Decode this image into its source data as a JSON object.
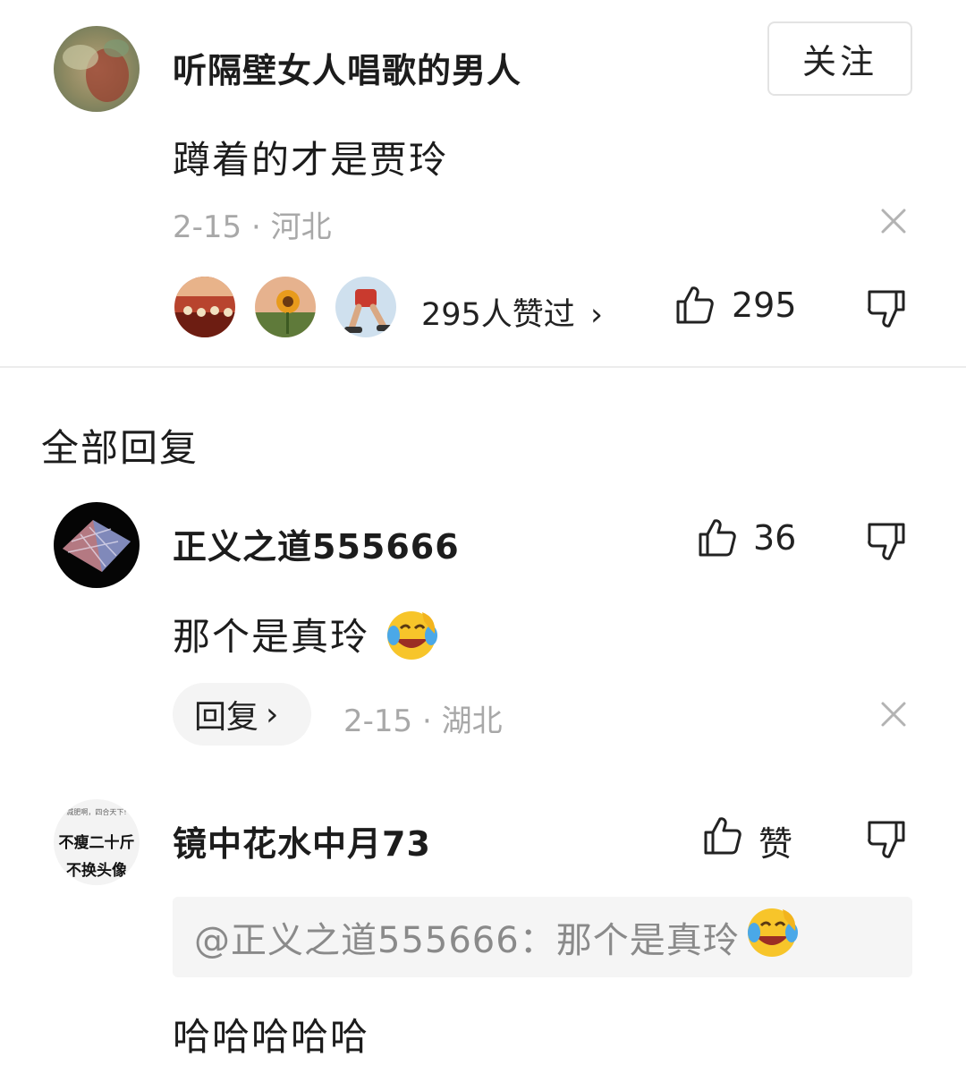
{
  "colors": {
    "text": "#1c1c1c",
    "meta": "#a8a8a8",
    "divider": "#ececec",
    "chip_bg": "#f4f4f4",
    "quote_bg": "#f5f5f5"
  },
  "main_comment": {
    "username": "听隔壁女人唱歌的男人",
    "follow_label": "关注",
    "text": "蹲着的才是贾玲",
    "meta": "2-15 · 河北",
    "likers_summary": "295人赞过",
    "likers_chevron": "›",
    "like_count": "295",
    "icons": [
      "avatar",
      "close-icon",
      "thumbs-up-icon",
      "thumbs-down-icon"
    ]
  },
  "section_title": "全部回复",
  "replies": [
    {
      "username": "正义之道555666",
      "like_count": "36",
      "text": "那个是真玲",
      "emoji": "rolling-laughing-emoji",
      "reply_label": "回复",
      "reply_chevron": "›",
      "meta": "2-15 · 湖北"
    },
    {
      "username": "镜中花水中月73",
      "like_label": "赞",
      "avatar_text_small": "减肥啊，四合天下!",
      "avatar_text_line1": "不瘦二十斤",
      "avatar_text_line2": "不换头像",
      "quote": "@正义之道555666：那个是真玲",
      "emoji": "rolling-laughing-emoji",
      "text": "哈哈哈哈哈"
    }
  ]
}
